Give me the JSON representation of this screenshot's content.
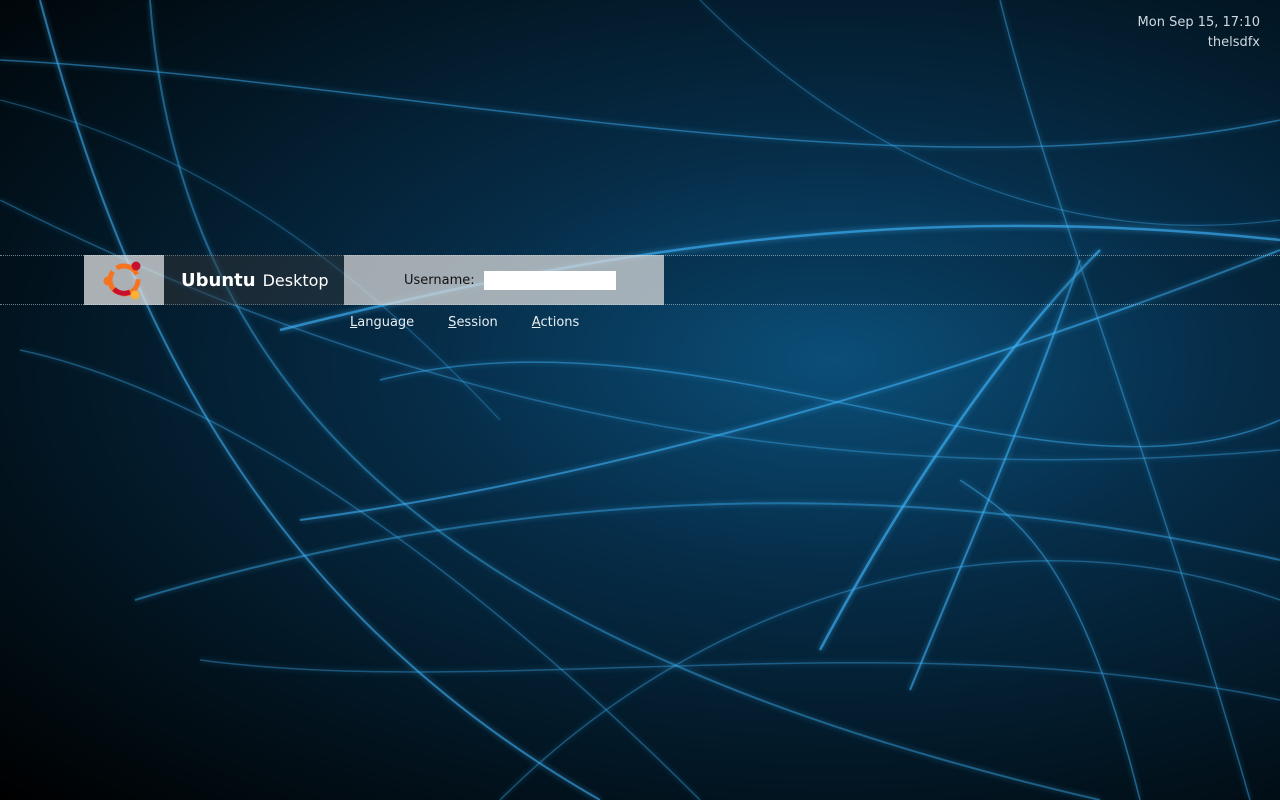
{
  "clock": {
    "datetime": "Mon Sep 15, 17:10",
    "hostname": "thelsdfx"
  },
  "brand": {
    "name_bold": "Ubuntu",
    "name_regular": "Desktop",
    "logo_icon": "ubuntu-circle-of-friends-icon"
  },
  "login": {
    "username_label": "Username:",
    "username_value": "",
    "username_placeholder": ""
  },
  "menu": [
    {
      "mnemonic": "L",
      "rest": "anguage"
    },
    {
      "mnemonic": "S",
      "rest": "ession"
    },
    {
      "mnemonic": "A",
      "rest": "ctions"
    }
  ],
  "colors": {
    "wallpaper_dark": "#021420",
    "wallpaper_glow": "#3fb8ff",
    "logo_orange": "#f47421",
    "logo_red": "#c8102e",
    "logo_yellow": "#fcb131"
  }
}
